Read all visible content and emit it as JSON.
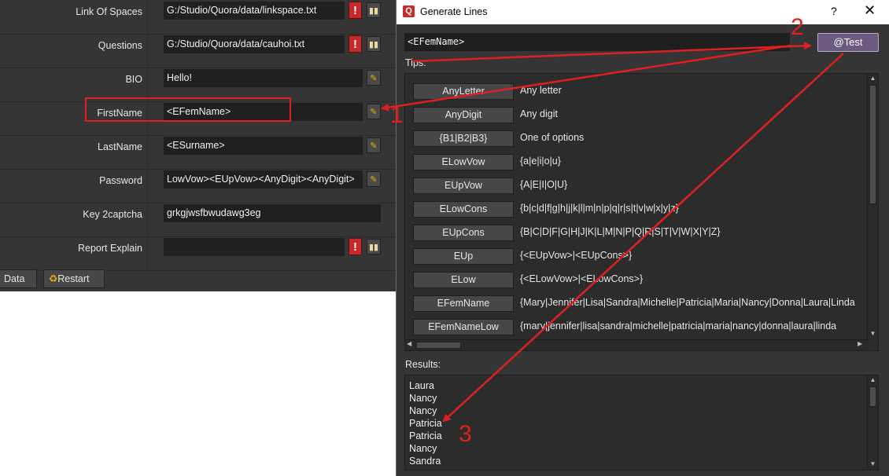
{
  "left_panel": {
    "rows": [
      {
        "label": "Link Of Spaces",
        "value": "G:/Studio/Quora/data/linkspace.txt"
      },
      {
        "label": "Questions",
        "value": "G:/Studio/Quora/data/cauhoi.txt"
      },
      {
        "label": "BIO",
        "value": "Hello!"
      },
      {
        "label": "FirstName",
        "value": "<EFemName>"
      },
      {
        "label": "LastName",
        "value": "<ESurname>"
      },
      {
        "label": "Password",
        "value": "LowVow><EUpVow><AnyDigit><AnyDigit>"
      },
      {
        "label": "Key 2captcha",
        "value": "grkgjwsfbwudawg3eg"
      },
      {
        "label": "Report Explain",
        "value": ""
      }
    ],
    "warn_glyph": "!",
    "buttons": {
      "data": "Data",
      "restart": "Restart"
    }
  },
  "dialog": {
    "title": "Generate Lines",
    "help": "?",
    "close": "✕",
    "pattern": "<EFemName>",
    "test_label": "Test",
    "test_at": "@",
    "tips_label": "Tips:",
    "tips": [
      {
        "name": "AnyLetter",
        "desc": "Any letter"
      },
      {
        "name": "AnyDigit",
        "desc": "Any digit"
      },
      {
        "name": "{B1|B2|B3}",
        "desc": "One of options"
      },
      {
        "name": "ELowVow",
        "desc": "{a|e|i|o|u}"
      },
      {
        "name": "EUpVow",
        "desc": "{A|E|I|O|U}"
      },
      {
        "name": "ELowCons",
        "desc": "{b|c|d|f|g|h|j|k|l|m|n|p|q|r|s|t|v|w|x|y|z}"
      },
      {
        "name": "EUpCons",
        "desc": "{B|C|D|F|G|H|J|K|L|M|N|P|Q|R|S|T|V|W|X|Y|Z}"
      },
      {
        "name": "EUp",
        "desc": "{<EUpVow>|<EUpCons>}"
      },
      {
        "name": "ELow",
        "desc": "{<ELowVow>|<ELowCons>}"
      },
      {
        "name": "EFemName",
        "desc": "{Mary|Jennifer|Lisa|Sandra|Michelle|Patricia|Maria|Nancy|Donna|Laura|Linda"
      },
      {
        "name": "EFemNameLow",
        "desc": "{mary|jennifer|lisa|sandra|michelle|patricia|maria|nancy|donna|laura|linda"
      }
    ],
    "results_label": "Results:",
    "results": [
      "Laura",
      "Nancy",
      "Nancy",
      "Patricia",
      "Patricia",
      "Nancy",
      "Sandra"
    ]
  },
  "annotations": {
    "one": "1",
    "two": "2",
    "three": "3"
  },
  "colors": {
    "annotation": "#e02020",
    "warn": "#c7282c",
    "test_button": "#6d5a80"
  }
}
